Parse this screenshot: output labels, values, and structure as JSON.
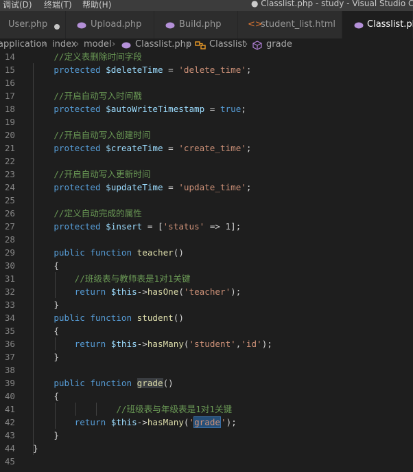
{
  "menu": {
    "debug": "调试(D)",
    "terminal": "终端(T)",
    "help": "帮助(H)"
  },
  "window_title": "● Classlist.php - study - Visual Studio Code",
  "tabs": [
    {
      "label": "User.php",
      "icon": "php-elephant-icon",
      "modified": true
    },
    {
      "label": "Upload.php",
      "icon": "php-elephant-icon"
    },
    {
      "label": "Build.php",
      "icon": "php-elephant-icon"
    },
    {
      "label": "student_list.html",
      "icon": "html-brackets-icon"
    },
    {
      "label": "Classlist.php",
      "icon": "php-elephant-icon",
      "active": true
    }
  ],
  "breadcrumb": {
    "p1": "application",
    "p2": "index",
    "p3": "model",
    "p4": "Classlist.php",
    "p5": "Classlist",
    "p6": "grade"
  },
  "colors": {
    "keyword": "#569cd6",
    "variable": "#9cdcfe",
    "string": "#ce9178",
    "comment": "#6a9955",
    "function": "#dcdcaa",
    "background": "#1e1e1e"
  },
  "lines": [
    {
      "n": "14",
      "t": [
        [
          "c",
          "    //定义表删除时间字段"
        ]
      ]
    },
    {
      "n": "15",
      "t": [
        [
          "k",
          "    protected "
        ],
        [
          "v",
          "$deleteTime"
        ],
        [
          "o",
          " = "
        ],
        [
          "s",
          "'delete_time'"
        ],
        [
          "o",
          ";"
        ]
      ]
    },
    {
      "n": "16",
      "t": []
    },
    {
      "n": "17",
      "t": [
        [
          "c",
          "    //开启自动写入时间戳"
        ]
      ]
    },
    {
      "n": "18",
      "t": [
        [
          "k",
          "    protected "
        ],
        [
          "v",
          "$autoWriteTimestamp"
        ],
        [
          "o",
          " = "
        ],
        [
          "k",
          "true"
        ],
        [
          "o",
          ";"
        ]
      ]
    },
    {
      "n": "19",
      "t": []
    },
    {
      "n": "20",
      "t": [
        [
          "c",
          "    //开启自动写入创建时间"
        ]
      ]
    },
    {
      "n": "21",
      "t": [
        [
          "k",
          "    protected "
        ],
        [
          "v",
          "$createTime"
        ],
        [
          "o",
          " = "
        ],
        [
          "s",
          "'create_time'"
        ],
        [
          "o",
          ";"
        ]
      ]
    },
    {
      "n": "22",
      "t": []
    },
    {
      "n": "23",
      "t": [
        [
          "c",
          "    //开启自动写入更新时间"
        ]
      ]
    },
    {
      "n": "24",
      "t": [
        [
          "k",
          "    protected "
        ],
        [
          "v",
          "$updateTime"
        ],
        [
          "o",
          " = "
        ],
        [
          "s",
          "'update_time'"
        ],
        [
          "o",
          ";"
        ]
      ]
    },
    {
      "n": "25",
      "t": []
    },
    {
      "n": "26",
      "t": [
        [
          "c",
          "    //定义自动完成的属性"
        ]
      ]
    },
    {
      "n": "27",
      "t": [
        [
          "k",
          "    protected "
        ],
        [
          "v",
          "$insert"
        ],
        [
          "o",
          " = ["
        ],
        [
          "s",
          "'status'"
        ],
        [
          "o",
          " => "
        ],
        [
          "o",
          "1];"
        ]
      ]
    },
    {
      "n": "28",
      "t": []
    },
    {
      "n": "29",
      "t": [
        [
          "k",
          "    public "
        ],
        [
          "k",
          "function "
        ],
        [
          "f",
          "teacher"
        ],
        [
          "o",
          "()"
        ]
      ]
    },
    {
      "n": "30",
      "t": [
        [
          "o",
          "    {"
        ]
      ]
    },
    {
      "n": "31",
      "t": [
        [
          "c",
          "        //班级表与教师表是1对1关键"
        ]
      ]
    },
    {
      "n": "32",
      "t": [
        [
          "k",
          "        return "
        ],
        [
          "v",
          "$this"
        ],
        [
          "o",
          "->"
        ],
        [
          "f",
          "hasOne"
        ],
        [
          "o",
          "("
        ],
        [
          "s",
          "'teacher'"
        ],
        [
          "o",
          ");"
        ]
      ]
    },
    {
      "n": "33",
      "t": [
        [
          "o",
          "    }"
        ]
      ]
    },
    {
      "n": "34",
      "t": [
        [
          "k",
          "    public "
        ],
        [
          "k",
          "function "
        ],
        [
          "f",
          "student"
        ],
        [
          "o",
          "()"
        ]
      ]
    },
    {
      "n": "35",
      "t": [
        [
          "o",
          "    {"
        ]
      ]
    },
    {
      "n": "36",
      "t": [
        [
          "k",
          "        return "
        ],
        [
          "v",
          "$this"
        ],
        [
          "o",
          "->"
        ],
        [
          "f",
          "hasMany"
        ],
        [
          "o",
          "("
        ],
        [
          "s",
          "'student'"
        ],
        [
          "o",
          ","
        ],
        [
          "s",
          "'id'"
        ],
        [
          "o",
          ");"
        ]
      ]
    },
    {
      "n": "37",
      "t": [
        [
          "o",
          "    }"
        ]
      ]
    },
    {
      "n": "38",
      "t": []
    },
    {
      "n": "39",
      "t": [
        [
          "k",
          "    public "
        ],
        [
          "k",
          "function "
        ],
        [
          "f fhl",
          "grade"
        ],
        [
          "o",
          "()"
        ]
      ]
    },
    {
      "n": "40",
      "t": [
        [
          "o",
          "    {"
        ]
      ]
    },
    {
      "n": "41",
      "t": [
        [
          "c",
          "                //班级表与年级表是1对1关键"
        ]
      ]
    },
    {
      "n": "42",
      "t": [
        [
          "k",
          "        return "
        ],
        [
          "v",
          "$this"
        ],
        [
          "o",
          "->"
        ],
        [
          "f",
          "hasMany"
        ],
        [
          "o",
          "("
        ],
        [
          "s",
          "'"
        ],
        [
          "s hl",
          "grade"
        ],
        [
          "cur",
          ""
        ],
        [
          "s",
          "'"
        ],
        [
          "o",
          ");"
        ]
      ]
    },
    {
      "n": "43",
      "t": [
        [
          "o",
          "    }"
        ]
      ]
    },
    {
      "n": "44",
      "t": [
        [
          "o",
          "}"
        ]
      ]
    },
    {
      "n": "45",
      "t": []
    }
  ]
}
